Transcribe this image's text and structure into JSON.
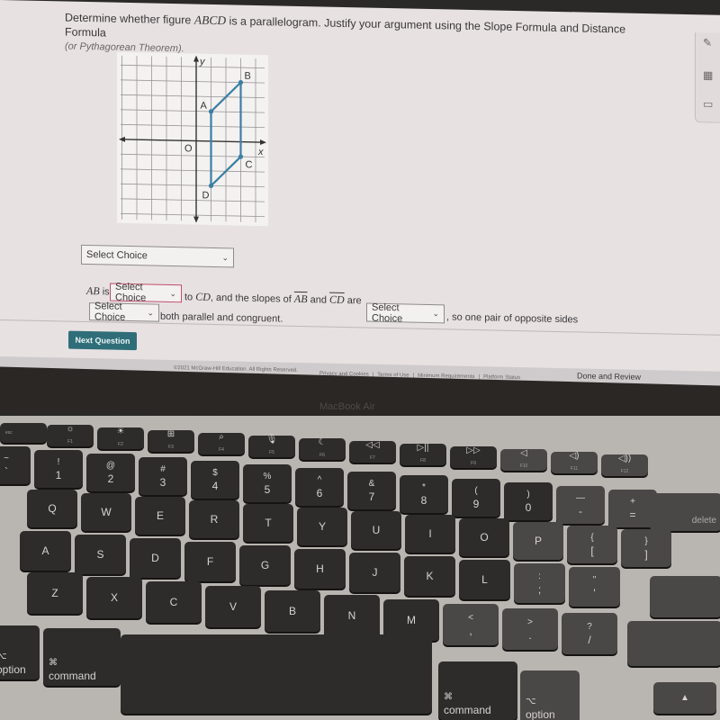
{
  "question": {
    "text_prefix": "Determine whether figure ",
    "figure_name": "ABCD",
    "text_suffix": " is a parallelogram. Justify your argument using the Slope Formula and Distance Formula",
    "subtext": "(or Pythagorean Theorem)."
  },
  "graph": {
    "x_label": "x",
    "y_label": "y",
    "origin_label": "O",
    "line_color": "#3b7fa3",
    "points": [
      {
        "label": "A",
        "x": 1,
        "y": 2
      },
      {
        "label": "B",
        "x": 3,
        "y": 4
      },
      {
        "label": "C",
        "x": 3,
        "y": -1
      },
      {
        "label": "D",
        "x": 1,
        "y": -3
      }
    ],
    "x_range": [
      -6,
      5
    ],
    "y_range": [
      -4,
      5
    ]
  },
  "answer": {
    "select_1": {
      "value": "Select Choice"
    },
    "line1": {
      "seg1": "AB",
      "is": " is",
      "select": "Select Choice",
      "to": " to ",
      "seg2": "CD",
      "mid": ", and the slopes of ",
      "seg3": "AB",
      "and": " and ",
      "seg4": "CD",
      "are": " are"
    },
    "select_3": "Select Choice",
    "tail": ", so one pair of opposite sides",
    "select_4": "Select Choice",
    "line2_tail": " both parallel and congruent."
  },
  "buttons": {
    "next_question": "Next Question",
    "done_review": "Done and Review"
  },
  "footer": {
    "copyright": "©2021 McGraw-Hill Education. All Rights Reserved.",
    "links": [
      "Privacy and Cookies",
      "Terms of Use",
      "Minimum Requirements",
      "Platform Status"
    ]
  },
  "toolbar": [
    "pencil-icon",
    "calculator-icon",
    "keyboard-icon"
  ],
  "laptop": {
    "model": "MacBook Air",
    "keys": {
      "esc": "esc",
      "fn_row": [
        {
          "glyph": "☼",
          "fn": "F1"
        },
        {
          "glyph": "☀",
          "fn": "F2"
        },
        {
          "glyph": "⊞",
          "fn": "F3"
        },
        {
          "glyph": "⌕",
          "fn": "F4"
        },
        {
          "glyph": "🎙",
          "fn": "F5"
        },
        {
          "glyph": "☾",
          "fn": "F6"
        },
        {
          "glyph": "◁◁",
          "fn": "F7"
        },
        {
          "glyph": "▷||",
          "fn": "F8"
        },
        {
          "glyph": "▷▷",
          "fn": "F9"
        },
        {
          "glyph": "◁",
          "fn": "F10"
        },
        {
          "glyph": "◁)",
          "fn": "F11"
        },
        {
          "glyph": "◁))",
          "fn": "F12"
        }
      ],
      "num_row": [
        {
          "top": "~",
          "main": "`"
        },
        {
          "top": "!",
          "main": "1"
        },
        {
          "top": "@",
          "main": "2"
        },
        {
          "top": "#",
          "main": "3"
        },
        {
          "top": "$",
          "main": "4"
        },
        {
          "top": "%",
          "main": "5"
        },
        {
          "top": "^",
          "main": "6"
        },
        {
          "top": "&",
          "main": "7"
        },
        {
          "top": "*",
          "main": "8"
        },
        {
          "top": "(",
          "main": "9"
        },
        {
          "top": ")",
          "main": "0"
        },
        {
          "top": "—",
          "main": "-"
        },
        {
          "top": "+",
          "main": "="
        }
      ],
      "delete": "delete",
      "qwerty": [
        "Q",
        "W",
        "E",
        "R",
        "T",
        "Y",
        "U",
        "I",
        "O",
        "P",
        "{ [",
        "} ]"
      ],
      "asdf": [
        "A",
        "S",
        "D",
        "F",
        "G",
        "H",
        "J",
        "K",
        "L",
        ": ;",
        "\" '"
      ],
      "zxcv": [
        "Z",
        "X",
        "C",
        "V",
        "B",
        "N",
        "M",
        "< ,",
        "> .",
        "? /"
      ],
      "option_left": "option",
      "option_glyph": "⌥",
      "command_left": "command",
      "command_glyph": "⌘",
      "command_right": "command",
      "option_right": "option",
      "arrow_up": "▲"
    }
  }
}
